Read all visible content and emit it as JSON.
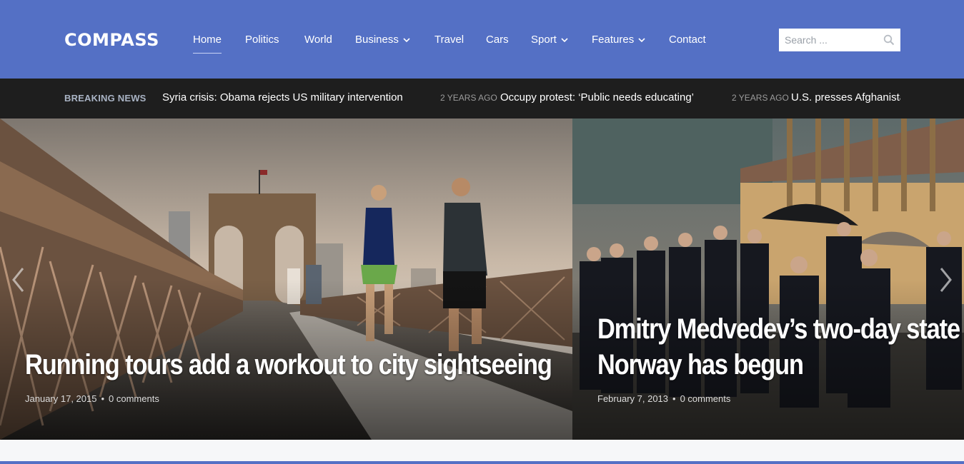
{
  "site": {
    "logo": "COMPASS"
  },
  "nav": {
    "items": [
      {
        "label": "Home",
        "active": true,
        "dropdown": false
      },
      {
        "label": "Politics",
        "dropdown": false
      },
      {
        "label": "World",
        "dropdown": false
      },
      {
        "label": "Business",
        "dropdown": true
      },
      {
        "label": "Travel",
        "dropdown": false
      },
      {
        "label": "Cars",
        "dropdown": false
      },
      {
        "label": "Sport",
        "dropdown": true
      },
      {
        "label": "Features",
        "dropdown": true
      },
      {
        "label": "Contact",
        "dropdown": false
      }
    ]
  },
  "search": {
    "placeholder": "Search ...",
    "icon": "search-icon"
  },
  "breaking": {
    "label": "BREAKING NEWS",
    "items": [
      {
        "time": "",
        "headline": "Syria crisis: Obama rejects US military intervention"
      },
      {
        "time": "2 YEARS AGO",
        "headline": "Occupy protest: ‘Public needs educating’"
      },
      {
        "time": "2 YEARS AGO",
        "headline": "U.S. presses Afghanistan"
      }
    ]
  },
  "slides": [
    {
      "title": "Running tours add a workout to city sightseeing",
      "date": "January 17, 2015",
      "separator": "•",
      "comments": "0 comments"
    },
    {
      "title_line1": "Dmitry Medvedev’s two-day state v",
      "title_line2": "Norway has begun",
      "date": "February 7, 2013",
      "separator": "•",
      "comments": "0 comments"
    }
  ],
  "colors": {
    "brand": "#5470c5",
    "ticker_bg": "#1e1e1e",
    "breaking_label": "#a9b3c4"
  }
}
